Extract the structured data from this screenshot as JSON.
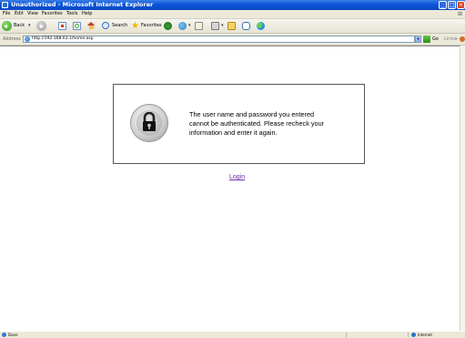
{
  "window": {
    "title": "Unauthorized - Microsoft Internet Explorer",
    "controls": {
      "minimize": "_",
      "maximize": "□",
      "close": "×"
    }
  },
  "menu": {
    "items": [
      "File",
      "Edit",
      "View",
      "Favorites",
      "Tools",
      "Help"
    ]
  },
  "toolbar": {
    "back_label": "Back",
    "search_label": "Search",
    "favorites_label": "Favorites",
    "dropdown_glyph": "▾",
    "icons": [
      "back-icon",
      "forward-icon",
      "stop-icon",
      "refresh-icon",
      "home-icon",
      "search-icon",
      "favorites-star-icon",
      "media-icon",
      "history-icon",
      "mail-icon",
      "print-icon",
      "edit-icon",
      "discuss-icon",
      "messenger-icon"
    ]
  },
  "address": {
    "label": "Address",
    "url": "http://192.168.63.1/home.asp",
    "go_label": "Go",
    "links_label": "Links",
    "links_chevron": "»"
  },
  "page": {
    "message": "The user name and password you entered\ncannot be authenticated. Please recheck your\ninformation and enter it again.",
    "login_link": "Login",
    "link_color": "#6b2fa3",
    "icon": "padlock-icon"
  },
  "status": {
    "text": "Done",
    "zone": "Internet"
  },
  "colors": {
    "titlebar": "#0b54d8",
    "chrome": "#ece9d8",
    "content_bg": "#ffffff"
  }
}
